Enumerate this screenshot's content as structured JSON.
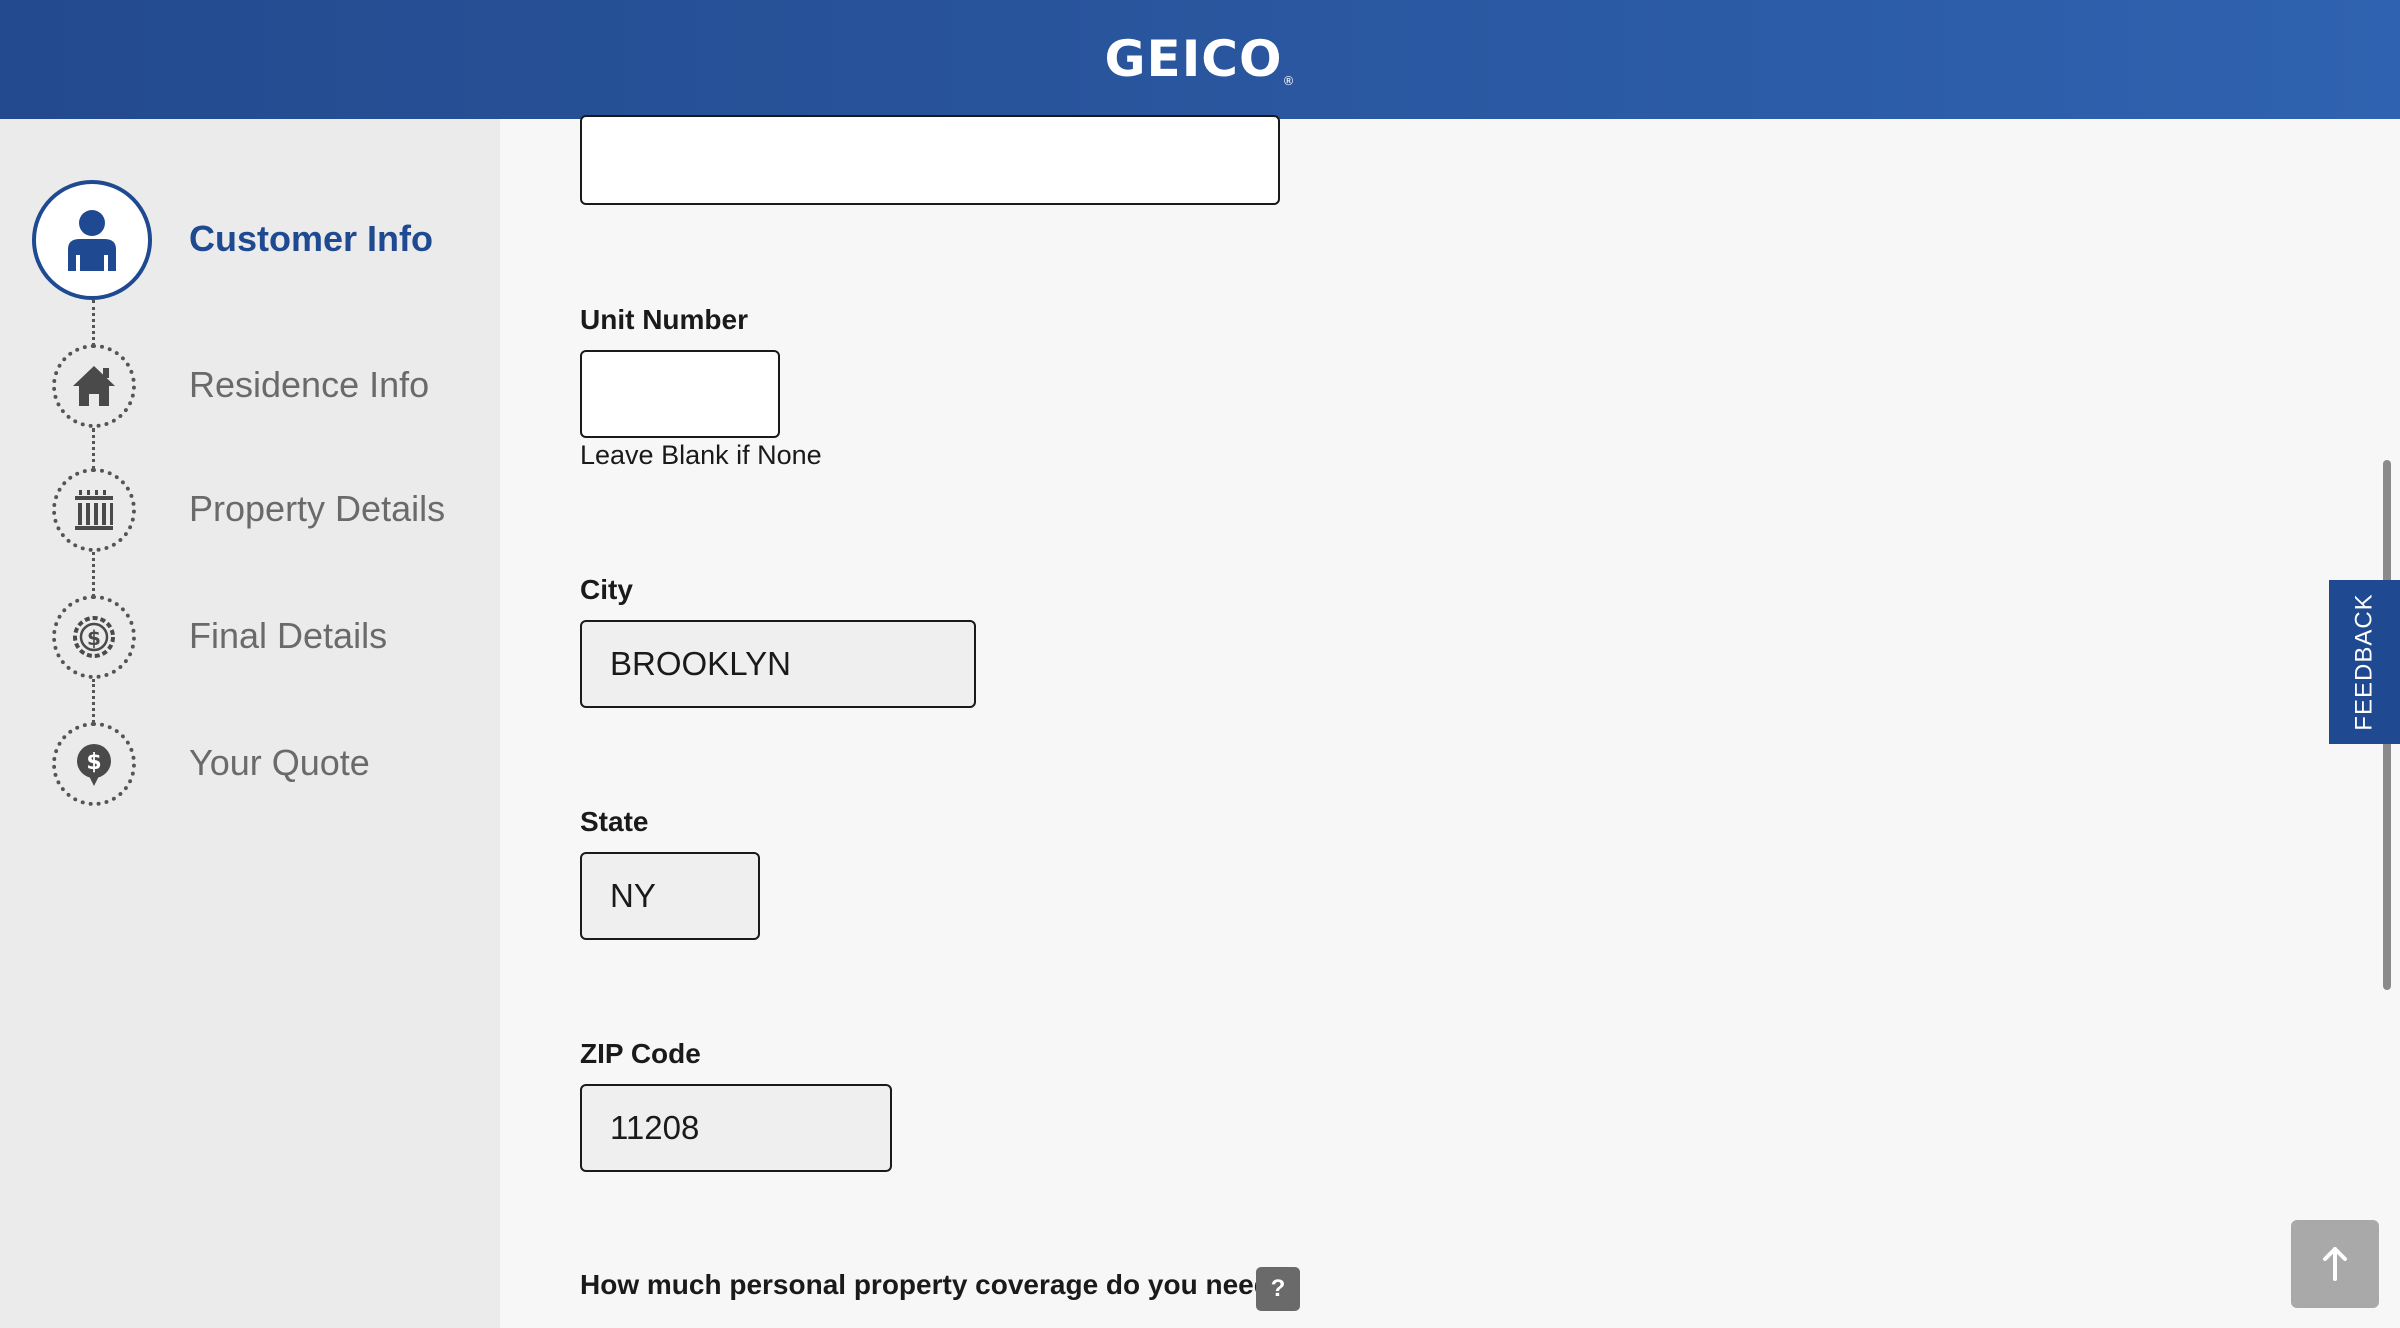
{
  "header": {
    "logo_text": "GEICO",
    "logo_mark": "®",
    "brand_color": "#2a57a0"
  },
  "sidebar": {
    "steps": [
      {
        "label": "Customer Info",
        "icon": "person-icon",
        "state": "active"
      },
      {
        "label": "Residence Info",
        "icon": "house-icon",
        "state": "pending"
      },
      {
        "label": "Property Details",
        "icon": "building-icon",
        "state": "pending"
      },
      {
        "label": "Final Details",
        "icon": "dollar-badge-icon",
        "state": "pending"
      },
      {
        "label": "Your Quote",
        "icon": "dollar-bubble-icon",
        "state": "pending"
      }
    ]
  },
  "form": {
    "street": {
      "value": ""
    },
    "unit": {
      "label": "Unit Number",
      "value": "",
      "hint": "Leave Blank if None"
    },
    "city": {
      "label": "City",
      "value": "BROOKLYN"
    },
    "state": {
      "label": "State",
      "value": "NY"
    },
    "zip": {
      "label": "ZIP Code",
      "value": "11208"
    },
    "coverage_question": "How much personal property coverage do you need?",
    "help_label": "?"
  },
  "feedback_label": "FEEDBACK"
}
